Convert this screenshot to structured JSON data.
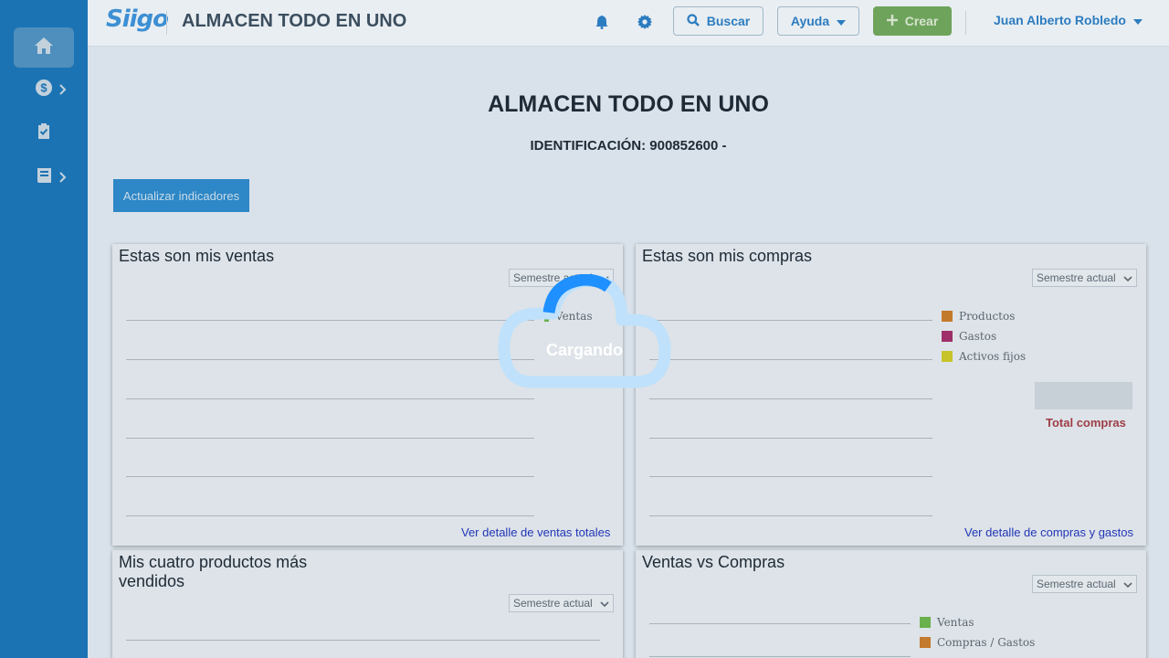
{
  "header": {
    "logo": "Siigo",
    "title": "ALMACEN TODO EN UNO",
    "buscar_label": "Buscar",
    "ayuda_label": "Ayuda",
    "crear_label": "Crear",
    "user_name": "Juan Alberto Robledo"
  },
  "sidebar": {
    "items": [
      {
        "icon": "home-icon"
      },
      {
        "icon": "dollar-icon"
      },
      {
        "icon": "clipboard-check-icon"
      },
      {
        "icon": "book-icon"
      }
    ]
  },
  "main": {
    "company_name": "ALMACEN TODO EN UNO",
    "identification": "IDENTIFICACIÓN: 900852600 -",
    "refresh_label": "Actualizar indicadores"
  },
  "panels": {
    "ventas": {
      "title": "Estas son mis ventas",
      "period": "Semestre actual",
      "legend": [
        "Ventas"
      ],
      "link": "Ver detalle de ventas totales"
    },
    "compras": {
      "title": "Estas son mis compras",
      "period": "Semestre actual",
      "legend": [
        "Productos",
        "Gastos",
        "Activos fijos"
      ],
      "total_label": "Total compras",
      "link": "Ver detalle de compras y gastos"
    },
    "productos": {
      "title_line1": "Mis cuatro productos más",
      "title_line2": "vendidos",
      "period": "Semestre actual"
    },
    "vs": {
      "title": "Ventas vs Compras",
      "period": "Semestre actual",
      "legend": [
        "Ventas",
        "Compras / Gastos"
      ]
    }
  },
  "loader": {
    "label": "Cargando"
  },
  "colors": {
    "sidebar": "#1b73b3",
    "ventas": "#6ab04c",
    "productos": "#c47a2c",
    "gastos": "#9e2f6a",
    "activos_fijos": "#c7c32b",
    "compras_gastos": "#c47a2c",
    "loader_arc": "#1e90ff"
  }
}
